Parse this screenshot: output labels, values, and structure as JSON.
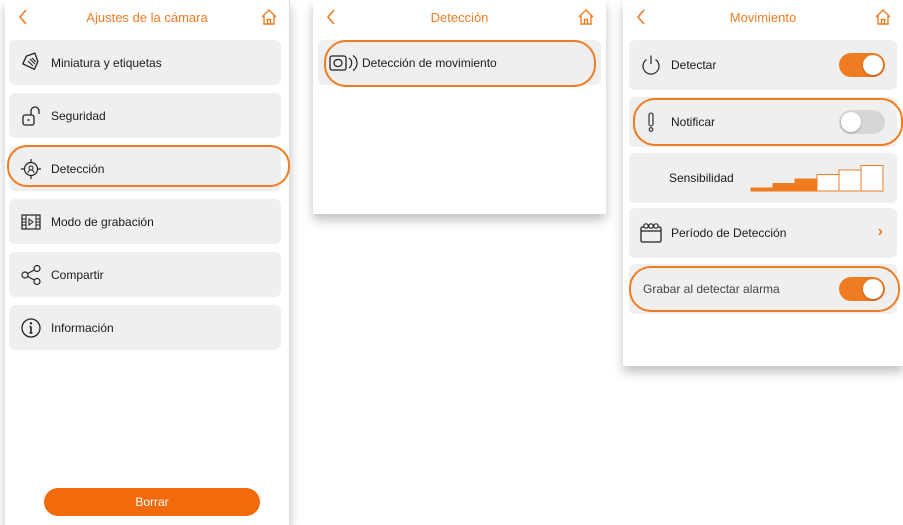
{
  "panel1": {
    "title": "Ajustes de la cámara",
    "items": [
      {
        "label": "Miniatura y etiquetas",
        "icon": "tag-icon"
      },
      {
        "label": "Seguridad",
        "icon": "unlock-icon"
      },
      {
        "label": "Detección",
        "icon": "detection-target-icon"
      },
      {
        "label": "Modo de grabación",
        "icon": "film-icon"
      },
      {
        "label": "Compartir",
        "icon": "share-icon"
      },
      {
        "label": "Información",
        "icon": "info-icon"
      }
    ],
    "delete_label": "Borrar"
  },
  "panel2": {
    "title": "Detección",
    "items": [
      {
        "label": "Detección de movimiento",
        "icon": "motion-sensor-icon"
      }
    ]
  },
  "panel3": {
    "title": "Movimiento",
    "detect": {
      "label": "Detectar",
      "on": true
    },
    "notify": {
      "label": "Notificar",
      "on": false
    },
    "sensitivity": {
      "label": "Sensibilidad",
      "level": 3,
      "max": 6
    },
    "period": {
      "label": "Período de Detección"
    },
    "record": {
      "label": "Grabar al detectar alarma",
      "on": true
    }
  },
  "colors": {
    "accent": "#f07c22",
    "card": "#efefef",
    "toggle_off": "#d6d6d6"
  }
}
